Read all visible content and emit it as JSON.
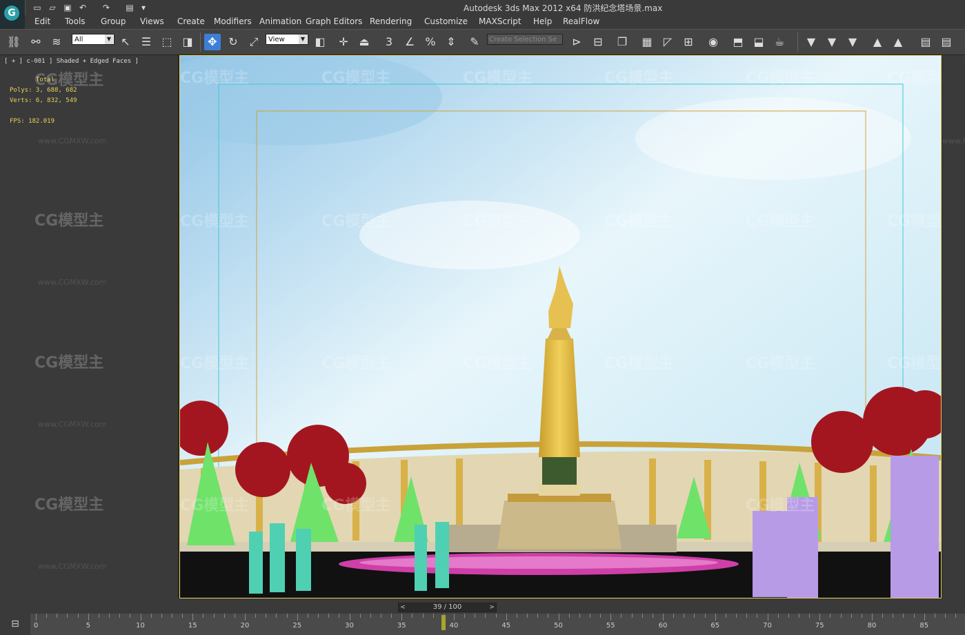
{
  "title_bar": {
    "window_title": "Autodesk 3ds Max  2012 x64      防洪纪念塔场景.max"
  },
  "menu": [
    "Edit",
    "Tools",
    "Group",
    "Views",
    "Create",
    "Modifiers",
    "Animation",
    "Graph Editors",
    "Rendering",
    "Customize",
    "MAXScript",
    "Help",
    "RealFlow"
  ],
  "toolbar": {
    "selection_filter": "All",
    "reference_coord": "View",
    "snap_label": "3",
    "angle_snap_label": "%",
    "named_selection_placeholder": "Create Selection Se"
  },
  "left_viewport": {
    "label": "[ + ] c-001 ] Shaded + Edged Faces ]",
    "stats_header": "Total",
    "polys": "Polys: 3, 688, 682",
    "verts": "Verts: 6, 832, 549",
    "fps": "FPS:   182.019"
  },
  "watermarks": {
    "brand": "CG模型主",
    "url": "www.CGMXW.com"
  },
  "timeline": {
    "current": "39 / 100",
    "frame_fraction": 0.39,
    "ticks": [
      "0",
      "5",
      "10",
      "15",
      "20",
      "25",
      "30",
      "35",
      "40",
      "45",
      "50",
      "55",
      "60",
      "65",
      "70",
      "75",
      "80",
      "85"
    ]
  }
}
